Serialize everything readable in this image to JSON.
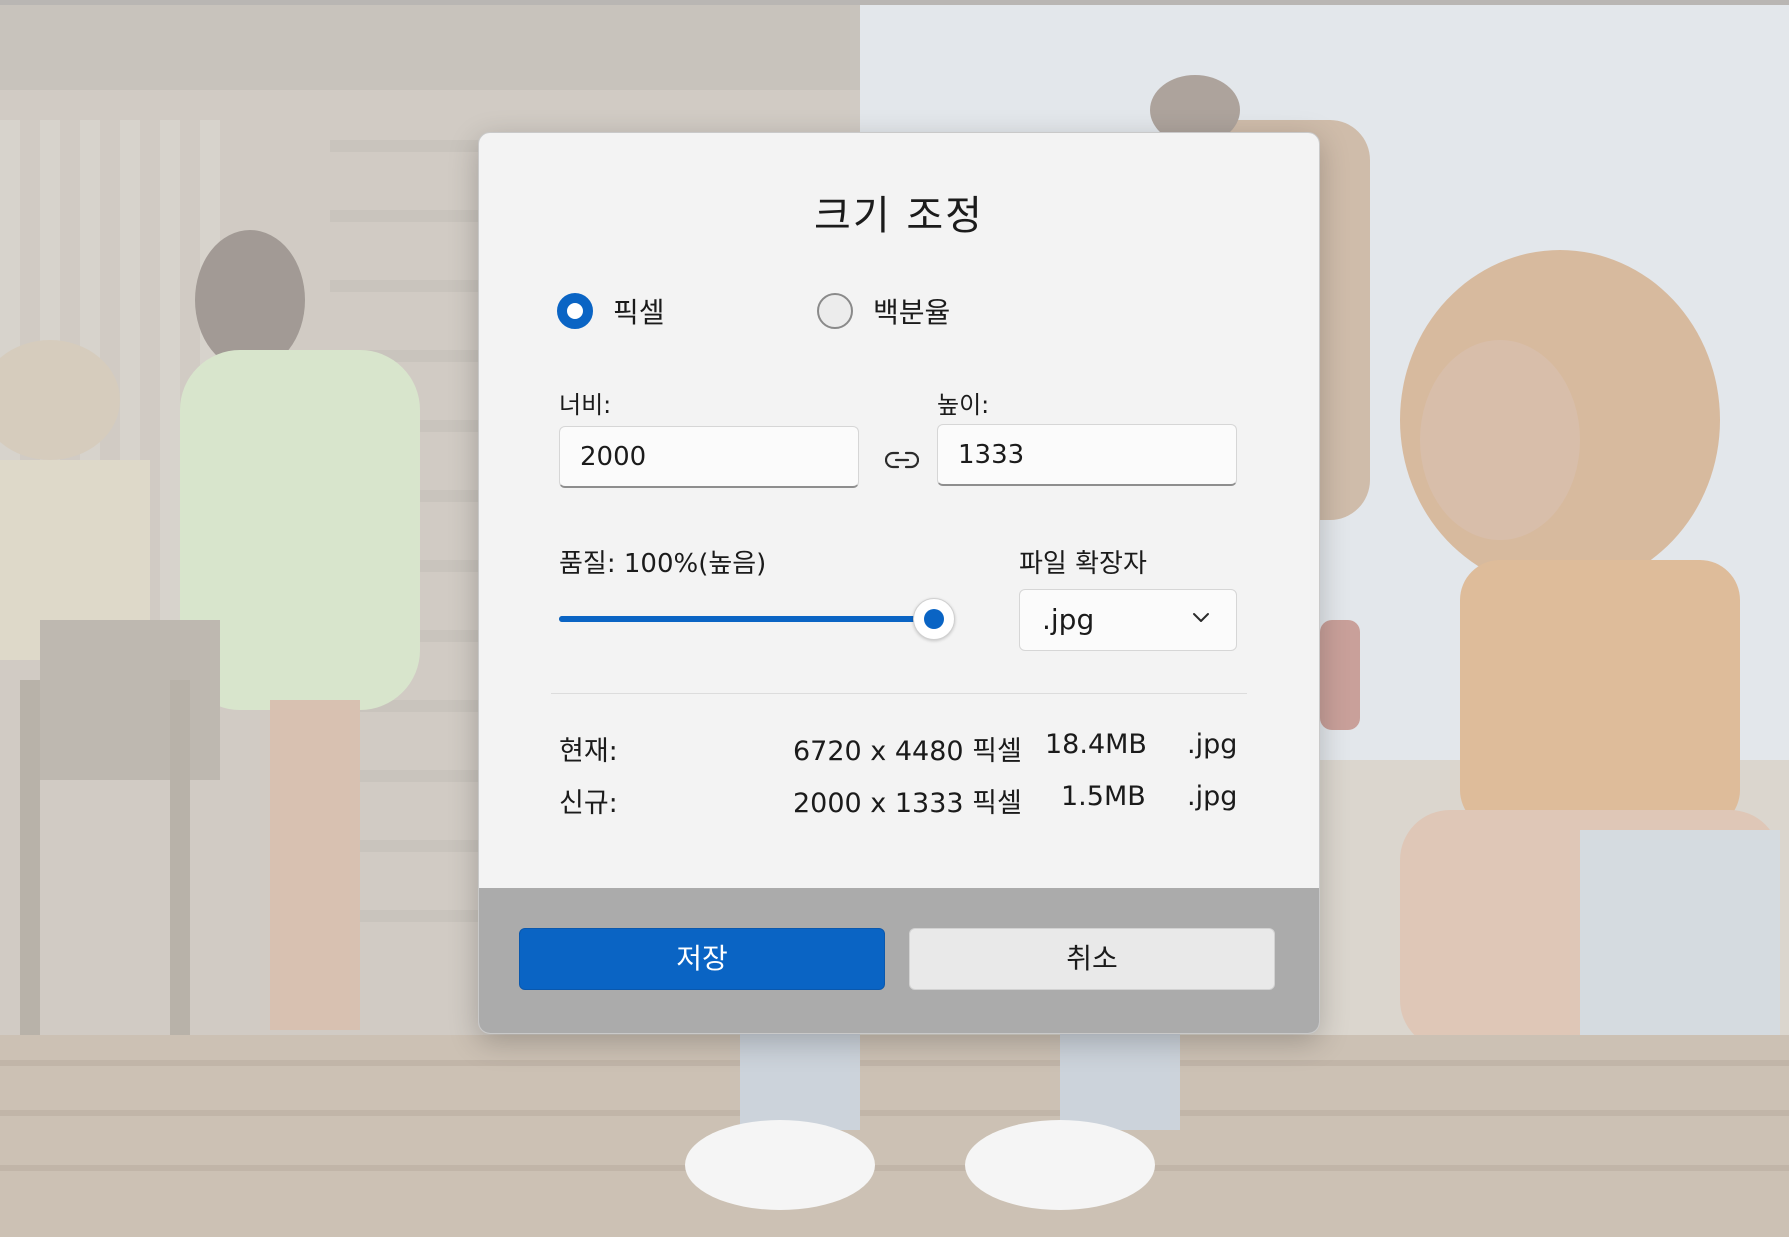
{
  "dialog": {
    "title": "크기 조정",
    "mode_options": [
      {
        "label": "픽셀",
        "selected": true
      },
      {
        "label": "백분율",
        "selected": false
      }
    ],
    "width_label": "너비:",
    "width_value": "2000",
    "height_label": "높이:",
    "height_value": "1333",
    "aspect_lock_icon": "link-icon",
    "quality_label": "품질: 100%(높음)",
    "quality_value": 1.0,
    "extension_label": "파일 확장자",
    "extension_selected": ".jpg",
    "current": {
      "label": "현재:",
      "dimensions": "6720 x 4480 픽셀",
      "size": "18.4MB",
      "ext": ".jpg"
    },
    "new": {
      "label": "신규:",
      "dimensions": "2000 x 1333 픽셀",
      "size": "1.5MB",
      "ext": ".jpg"
    },
    "save_label": "저장",
    "cancel_label": "취소"
  },
  "colors": {
    "accent": "#0a64c4",
    "dialog_bg": "#f3f3f3",
    "footer_bg": "#ababab"
  }
}
